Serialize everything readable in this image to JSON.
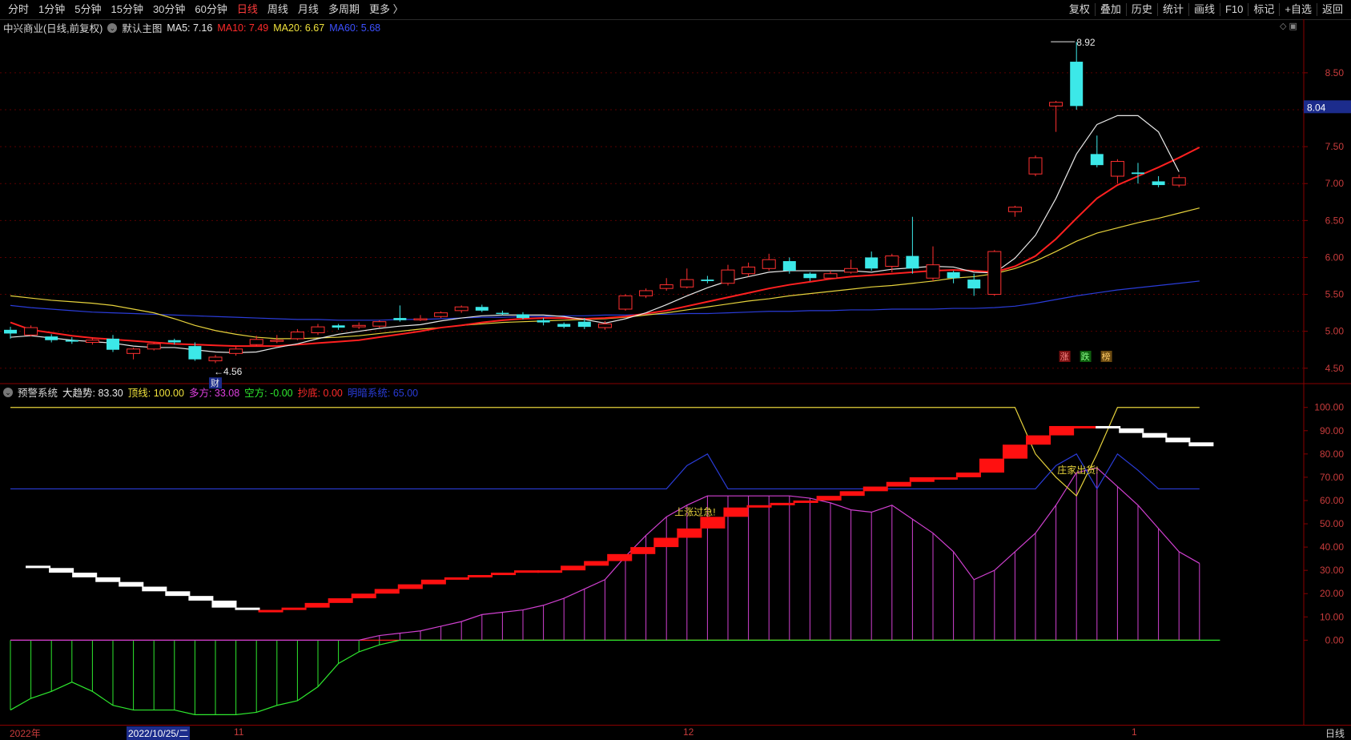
{
  "toolbar": {
    "left": [
      "分时",
      "1分钟",
      "5分钟",
      "15分钟",
      "30分钟",
      "60分钟",
      "日线",
      "周线",
      "月线",
      "多周期",
      "更多 〉"
    ],
    "active": "日线",
    "right": [
      "复权",
      "叠加",
      "历史",
      "统计",
      "画线",
      "F10",
      "标记",
      "+自选",
      "返回"
    ]
  },
  "main_info": {
    "title": "中兴商业(日线,前复权)",
    "template": "默认主图",
    "ma5": "MA5: 7.16",
    "ma10": "MA10: 7.49",
    "ma20": "MA20: 6.67",
    "ma60": "MA60: 5.68"
  },
  "sub_info": {
    "name": "预警系统",
    "trend": "大趋势: 83.30",
    "top": "顶线: 100.00",
    "long": "多方: 33.08",
    "short": "空方: -0.00",
    "bottom": "抄底: 0.00",
    "alarm": "明暗系统: 65.00"
  },
  "chart_data": [
    {
      "type": "candlestick",
      "title": "中兴商业(日线,前复权)",
      "ylim": [
        4.4,
        8.9
      ],
      "y_ticks": [
        "8.50",
        "8.00",
        "7.50",
        "7.00",
        "6.50",
        "6.00",
        "5.50",
        "5.00",
        "4.50"
      ],
      "current_price": "8.04",
      "high_label": "8.92",
      "low_label": "4.56",
      "low_marker": "财",
      "signal_labels": [
        "涨",
        "跌",
        "榜"
      ],
      "candles": [
        [
          5.02,
          4.97,
          5.06,
          4.9
        ],
        [
          4.95,
          5.05,
          5.08,
          4.93
        ],
        [
          4.93,
          4.88,
          4.96,
          4.85
        ],
        [
          4.88,
          4.86,
          4.92,
          4.83
        ],
        [
          4.85,
          4.88,
          4.92,
          4.82
        ],
        [
          4.9,
          4.75,
          4.95,
          4.72
        ],
        [
          4.7,
          4.76,
          4.78,
          4.62
        ],
        [
          4.76,
          4.83,
          4.85,
          4.74
        ],
        [
          4.88,
          4.85,
          4.9,
          4.82
        ],
        [
          4.8,
          4.62,
          4.85,
          4.6
        ],
        [
          4.6,
          4.65,
          4.68,
          4.57
        ],
        [
          4.7,
          4.76,
          4.8,
          4.67
        ],
        [
          4.82,
          4.89,
          4.94,
          4.8
        ],
        [
          4.88,
          4.88,
          4.95,
          4.84
        ],
        [
          4.9,
          4.99,
          5.03,
          4.88
        ],
        [
          4.98,
          5.06,
          5.1,
          4.95
        ],
        [
          5.08,
          5.05,
          5.1,
          5.02
        ],
        [
          5.06,
          5.08,
          5.12,
          5.03
        ],
        [
          5.07,
          5.13,
          5.15,
          5.05
        ],
        [
          5.18,
          5.15,
          5.35,
          5.13
        ],
        [
          5.17,
          5.17,
          5.22,
          5.14
        ],
        [
          5.2,
          5.25,
          5.27,
          5.18
        ],
        [
          5.28,
          5.33,
          5.35,
          5.25
        ],
        [
          5.33,
          5.28,
          5.36,
          5.26
        ],
        [
          5.25,
          5.24,
          5.28,
          5.22
        ],
        [
          5.23,
          5.18,
          5.26,
          5.16
        ],
        [
          5.15,
          5.12,
          5.18,
          5.08
        ],
        [
          5.1,
          5.06,
          5.12,
          5.04
        ],
        [
          5.13,
          5.06,
          5.18,
          5.03
        ],
        [
          5.05,
          5.1,
          5.14,
          5.02
        ],
        [
          5.3,
          5.48,
          5.5,
          5.28
        ],
        [
          5.48,
          5.55,
          5.58,
          5.45
        ],
        [
          5.58,
          5.63,
          5.72,
          5.55
        ],
        [
          5.6,
          5.7,
          5.85,
          5.58
        ],
        [
          5.7,
          5.68,
          5.75,
          5.65
        ],
        [
          5.65,
          5.83,
          5.9,
          5.62
        ],
        [
          5.78,
          5.87,
          5.93,
          5.74
        ],
        [
          5.85,
          5.97,
          6.05,
          5.82
        ],
        [
          5.95,
          5.82,
          6.0,
          5.78
        ],
        [
          5.78,
          5.72,
          5.8,
          5.68
        ],
        [
          5.72,
          5.78,
          5.82,
          5.7
        ],
        [
          5.8,
          5.85,
          5.97,
          5.78
        ],
        [
          6.0,
          5.85,
          6.08,
          5.82
        ],
        [
          5.88,
          6.02,
          6.05,
          5.8
        ],
        [
          6.02,
          5.85,
          6.55,
          5.78
        ],
        [
          5.72,
          5.9,
          6.15,
          5.68
        ],
        [
          5.8,
          5.72,
          5.82,
          5.65
        ],
        [
          5.7,
          5.58,
          5.78,
          5.48
        ],
        [
          5.5,
          6.08,
          6.1,
          5.48
        ],
        [
          6.62,
          6.68,
          6.7,
          6.55
        ],
        [
          7.13,
          7.35,
          7.38,
          7.1
        ],
        [
          8.05,
          8.1,
          8.12,
          7.7
        ],
        [
          8.65,
          8.05,
          8.92,
          8.0
        ],
        [
          7.4,
          7.25,
          7.65,
          7.22
        ],
        [
          7.1,
          7.3,
          7.33,
          7.0
        ],
        [
          7.15,
          7.13,
          7.28,
          7.0
        ],
        [
          7.03,
          6.98,
          7.1,
          6.95
        ],
        [
          6.98,
          7.08,
          7.12,
          6.95
        ]
      ],
      "ma5": [
        4.92,
        4.94,
        4.91,
        4.88,
        4.86,
        4.84,
        4.8,
        4.78,
        4.78,
        4.75,
        4.72,
        4.71,
        4.72,
        4.78,
        4.83,
        4.9,
        4.96,
        5.0,
        5.04,
        5.07,
        5.09,
        5.14,
        5.18,
        5.21,
        5.22,
        5.22,
        5.22,
        5.2,
        5.16,
        5.11,
        5.17,
        5.25,
        5.36,
        5.48,
        5.59,
        5.68,
        5.74,
        5.8,
        5.82,
        5.82,
        5.82,
        5.82,
        5.8,
        5.84,
        5.86,
        5.88,
        5.87,
        5.8,
        5.79,
        5.99,
        6.3,
        6.8,
        7.4,
        7.8,
        7.92,
        7.92,
        7.7,
        7.16
      ],
      "ma10": [
        5.12,
        5.02,
        4.98,
        4.94,
        4.91,
        4.89,
        4.87,
        4.85,
        4.83,
        4.82,
        4.81,
        4.8,
        4.8,
        4.8,
        4.82,
        4.84,
        4.86,
        4.88,
        4.92,
        4.96,
        5.0,
        5.05,
        5.08,
        5.12,
        5.15,
        5.17,
        5.18,
        5.18,
        5.17,
        5.18,
        5.2,
        5.24,
        5.28,
        5.34,
        5.4,
        5.46,
        5.52,
        5.58,
        5.63,
        5.67,
        5.71,
        5.74,
        5.76,
        5.78,
        5.8,
        5.82,
        5.83,
        5.82,
        5.8,
        5.88,
        6.02,
        6.25,
        6.53,
        6.8,
        6.98,
        7.1,
        7.22,
        7.35,
        7.49
      ],
      "ma20": [
        5.48,
        5.45,
        5.42,
        5.4,
        5.38,
        5.35,
        5.3,
        5.25,
        5.17,
        5.08,
        5.01,
        4.96,
        4.92,
        4.9,
        4.9,
        4.91,
        4.92,
        4.94,
        4.97,
        5.0,
        5.03,
        5.05,
        5.08,
        5.1,
        5.12,
        5.13,
        5.14,
        5.15,
        5.16,
        5.17,
        5.19,
        5.22,
        5.25,
        5.29,
        5.33,
        5.37,
        5.41,
        5.44,
        5.48,
        5.51,
        5.54,
        5.57,
        5.6,
        5.62,
        5.65,
        5.68,
        5.72,
        5.74,
        5.78,
        5.85,
        5.95,
        6.08,
        6.22,
        6.33,
        6.4,
        6.47,
        6.53,
        6.6,
        6.67
      ],
      "ma60": [
        5.35,
        5.32,
        5.3,
        5.28,
        5.26,
        5.25,
        5.24,
        5.23,
        5.22,
        5.21,
        5.2,
        5.19,
        5.18,
        5.17,
        5.16,
        5.16,
        5.15,
        5.15,
        5.15,
        5.16,
        5.16,
        5.17,
        5.18,
        5.19,
        5.19,
        5.2,
        5.2,
        5.21,
        5.21,
        5.22,
        5.22,
        5.23,
        5.23,
        5.24,
        5.24,
        5.25,
        5.26,
        5.27,
        5.27,
        5.28,
        5.28,
        5.29,
        5.29,
        5.3,
        5.3,
        5.3,
        5.31,
        5.31,
        5.32,
        5.34,
        5.38,
        5.43,
        5.48,
        5.52,
        5.56,
        5.59,
        5.62,
        5.65,
        5.68
      ]
    },
    {
      "type": "indicator",
      "title": "预警系统",
      "ylim": [
        -36,
        103
      ],
      "y_ticks": [
        "100.00",
        "90.00",
        "80.00",
        "70.00",
        "60.00",
        "50.00",
        "40.00",
        "30.00",
        "20.00",
        "10.00",
        "0.00"
      ],
      "annotations": [
        "上涨过急!",
        "庄家出货!"
      ],
      "top_line": [
        100,
        100,
        100,
        100,
        100,
        100,
        100,
        100,
        100,
        100,
        100,
        100,
        100,
        100,
        100,
        100,
        100,
        100,
        100,
        100,
        100,
        100,
        100,
        100,
        100,
        100,
        100,
        100,
        100,
        100,
        100,
        100,
        100,
        100,
        100,
        100,
        100,
        100,
        100,
        100,
        100,
        100,
        100,
        100,
        100,
        100,
        100,
        100,
        100,
        100,
        80,
        70,
        62,
        80,
        100,
        100,
        100,
        100,
        100,
        100
      ],
      "alarm_line": [
        65,
        65,
        65,
        65,
        65,
        65,
        65,
        65,
        65,
        65,
        65,
        65,
        65,
        65,
        65,
        65,
        65,
        65,
        65,
        65,
        65,
        65,
        65,
        65,
        65,
        65,
        65,
        65,
        65,
        65,
        65,
        65,
        65,
        75,
        80,
        65,
        65,
        65,
        65,
        65,
        65,
        65,
        65,
        65,
        65,
        65,
        65,
        65,
        65,
        65,
        65,
        75,
        80,
        65,
        80,
        73,
        65,
        65,
        65,
        65
      ],
      "long_line": [
        0,
        0,
        0,
        0,
        0,
        0,
        0,
        0,
        0,
        0,
        0,
        0,
        0,
        0,
        0,
        0,
        0,
        0,
        2,
        3,
        4,
        6,
        8,
        11,
        12,
        13,
        15,
        18,
        22,
        26,
        36,
        45,
        53,
        58,
        62,
        62,
        62,
        62,
        62,
        61,
        59,
        56,
        55,
        58,
        52,
        46,
        38,
        26,
        30,
        38,
        46,
        58,
        72,
        74,
        66,
        58,
        48,
        38,
        33
      ],
      "short_line": [
        -30,
        -25,
        -22,
        -18,
        -22,
        -28,
        -30,
        -30,
        -30,
        -32,
        -32,
        -32,
        -31,
        -28,
        -26,
        -20,
        -10,
        -5,
        -2,
        0,
        0,
        0,
        0,
        0,
        0,
        0,
        0,
        0,
        0,
        0,
        0,
        0,
        0,
        0,
        0,
        0,
        0,
        0,
        0,
        0,
        0,
        0,
        0,
        0,
        0,
        0,
        0,
        0,
        0,
        0,
        0,
        0,
        0,
        0,
        0,
        0,
        0,
        0,
        0,
        0
      ],
      "trend": [
        32,
        31,
        29,
        27,
        25,
        23,
        21,
        19,
        17,
        14,
        13,
        13,
        14,
        16,
        18,
        20,
        22,
        24,
        26,
        27,
        28,
        29,
        30,
        30,
        32,
        34,
        37,
        40,
        44,
        48,
        53,
        57,
        58,
        59,
        60,
        62,
        64,
        66,
        68,
        70,
        70,
        72,
        78,
        84,
        88,
        92,
        92,
        91,
        89,
        87,
        85,
        83.3
      ]
    }
  ],
  "bottom_bar": {
    "year_label": "2022年",
    "selected_date": "2022/10/25/二",
    "month_11": "11",
    "month_12": "12",
    "month_1": "1",
    "period": "日线"
  }
}
